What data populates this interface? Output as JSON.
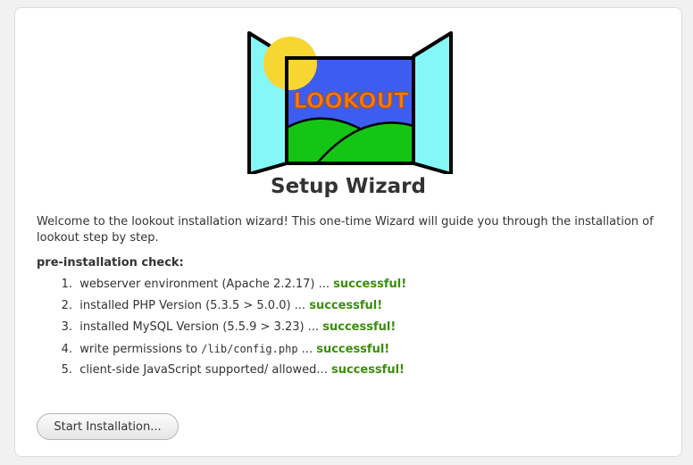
{
  "logo": {
    "text": "LOOKOUT",
    "icon": "window-logo-icon",
    "colors": {
      "sky": "#3d5cf0",
      "sun": "#f8d631",
      "grass": "#15c515",
      "shutter": "#85f7f7",
      "lettering": "#f07a18"
    }
  },
  "page": {
    "title": "Setup Wizard",
    "intro": "Welcome to the lookout installation wizard! This one-time Wizard will guide you through the installation of lookout step by step."
  },
  "check": {
    "heading": "pre-installation check:",
    "items": [
      {
        "num": "1.",
        "before": "webserver environment (Apache 2.2.17) ... ",
        "code": "",
        "after": "",
        "status": "successful!"
      },
      {
        "num": "2.",
        "before": "installed PHP Version (5.3.5 > 5.0.0) ... ",
        "code": "",
        "after": "",
        "status": "successful!"
      },
      {
        "num": "3.",
        "before": "installed MySQL Version (5.5.9 > 3.23) ... ",
        "code": "",
        "after": "",
        "status": "successful!"
      },
      {
        "num": "4.",
        "before": "write permissions to ",
        "code": "/lib/config.php",
        "after": " ... ",
        "status": "successful!"
      },
      {
        "num": "5.",
        "before": "client-side JavaScript supported/ allowed... ",
        "code": "",
        "after": "",
        "status": "successful!"
      }
    ],
    "status_color": "#3a8e0b"
  },
  "actions": {
    "start_label": "Start Installation..."
  }
}
